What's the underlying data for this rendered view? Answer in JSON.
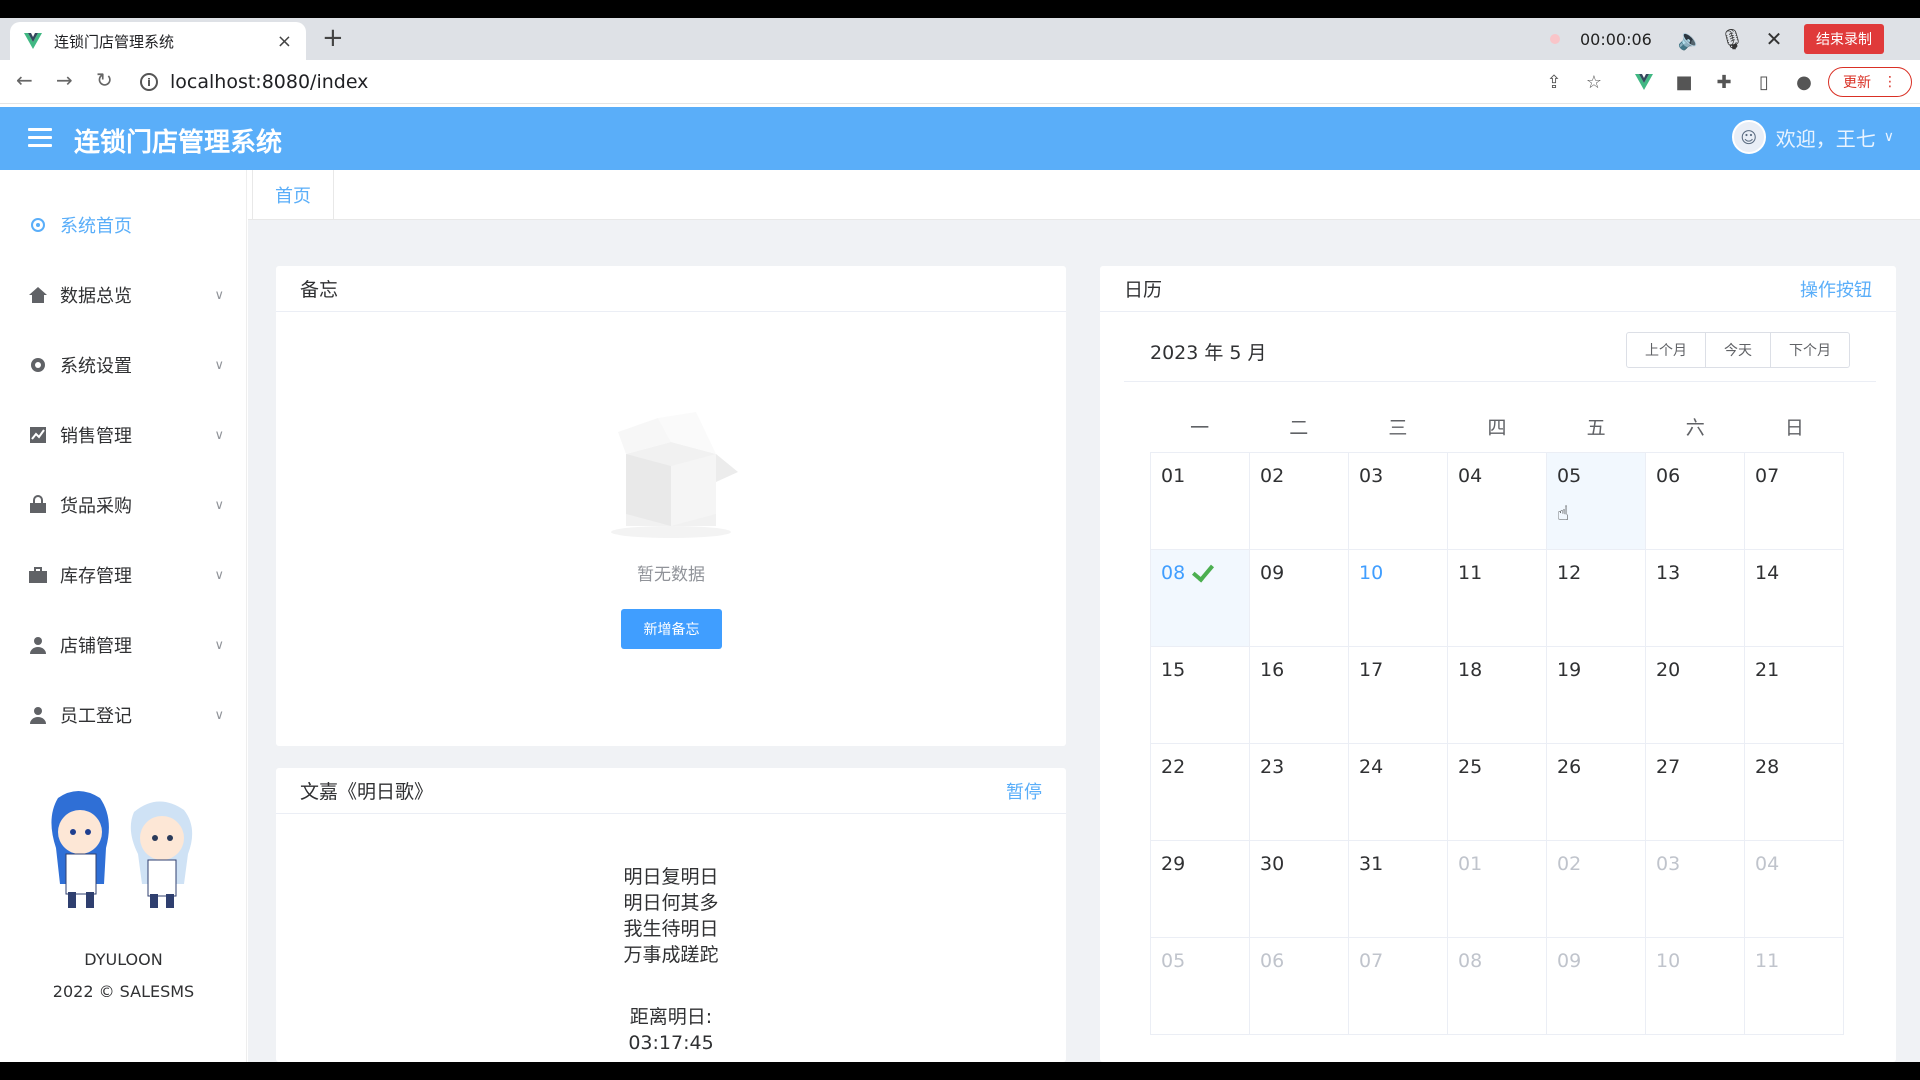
{
  "browser": {
    "tab_title": "连锁门店管理系统",
    "tab_close": "×",
    "new_tab": "+",
    "url": "localhost:8080/index",
    "rec_time": "00:00:06",
    "rec_stop": "结束录制",
    "update_label": "更新"
  },
  "header": {
    "title": "连锁门店管理系统",
    "welcome": "欢迎，王七"
  },
  "sidebar": {
    "items": [
      {
        "label": "系统首页",
        "icon": "gear-icon"
      },
      {
        "label": "数据总览",
        "icon": "home-icon"
      },
      {
        "label": "系统设置",
        "icon": "settings-icon"
      },
      {
        "label": "销售管理",
        "icon": "chart-icon"
      },
      {
        "label": "货品采购",
        "icon": "lock-bag-icon"
      },
      {
        "label": "库存管理",
        "icon": "briefcase-icon"
      },
      {
        "label": "店铺管理",
        "icon": "user-icon"
      },
      {
        "label": "员工登记",
        "icon": "user-icon"
      }
    ],
    "brand": "DYULOON",
    "copyright": "2022 © SALESMS"
  },
  "breadcrumb": {
    "home": "首页"
  },
  "memo": {
    "title": "备忘",
    "empty": "暂无数据",
    "add_button": "新增备忘"
  },
  "poem": {
    "title": "文嘉《明日歌》",
    "action": "暂停",
    "lines": [
      "明日复明日",
      "明日何其多",
      "我生待明日",
      "万事成蹉跎"
    ],
    "countdown_label": "距离明日:",
    "countdown_value": "03:17:45"
  },
  "calendar": {
    "title": "日历",
    "action": "操作按钮",
    "month_label": "2023 年 5 月",
    "buttons": [
      "上个月",
      "今天",
      "下个月"
    ],
    "weekdays": [
      "一",
      "二",
      "三",
      "四",
      "五",
      "六",
      "日"
    ],
    "today": "08",
    "hovered": "05",
    "weeks": [
      [
        {
          "d": "01"
        },
        {
          "d": "02"
        },
        {
          "d": "03"
        },
        {
          "d": "04"
        },
        {
          "d": "05",
          "hover": true
        },
        {
          "d": "06"
        },
        {
          "d": "07"
        }
      ],
      [
        {
          "d": "08",
          "today": true
        },
        {
          "d": "09"
        },
        {
          "d": "10",
          "selected": true
        },
        {
          "d": "11"
        },
        {
          "d": "12"
        },
        {
          "d": "13"
        },
        {
          "d": "14"
        }
      ],
      [
        {
          "d": "15"
        },
        {
          "d": "16"
        },
        {
          "d": "17"
        },
        {
          "d": "18"
        },
        {
          "d": "19"
        },
        {
          "d": "20"
        },
        {
          "d": "21"
        }
      ],
      [
        {
          "d": "22"
        },
        {
          "d": "23"
        },
        {
          "d": "24"
        },
        {
          "d": "25"
        },
        {
          "d": "26"
        },
        {
          "d": "27"
        },
        {
          "d": "28"
        }
      ],
      [
        {
          "d": "29"
        },
        {
          "d": "30"
        },
        {
          "d": "31"
        },
        {
          "d": "01",
          "other": true
        },
        {
          "d": "02",
          "other": true
        },
        {
          "d": "03",
          "other": true
        },
        {
          "d": "04",
          "other": true
        }
      ],
      [
        {
          "d": "05",
          "other": true
        },
        {
          "d": "06",
          "other": true
        },
        {
          "d": "07",
          "other": true
        },
        {
          "d": "08",
          "other": true
        },
        {
          "d": "09",
          "other": true
        },
        {
          "d": "10",
          "other": true
        },
        {
          "d": "11",
          "other": true
        }
      ]
    ]
  },
  "colors": {
    "accent": "#5aaef9",
    "primary_button": "#409eff",
    "record_stop": "#e03a3a",
    "check": "#4caf50"
  }
}
